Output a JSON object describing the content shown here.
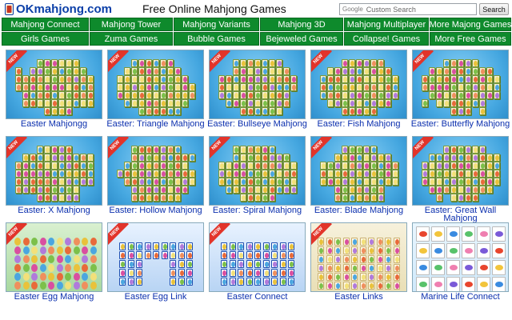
{
  "header": {
    "logo_text": "OKmahjong.com",
    "title": "Free Online Mahjong Games",
    "search_brand": "Google",
    "search_placeholder": "Custom Search",
    "search_button": "Search"
  },
  "nav": {
    "rows": [
      [
        "Mahjong Connect",
        "Mahjong Tower",
        "Mahjong Variants",
        "Mahjong 3D",
        "Mahjong Multiplayer",
        "More Majong Games"
      ],
      [
        "Girls Games",
        "Zuma Games",
        "Bubble Games",
        "Bejeweled Games",
        "Collapse! Games",
        "More Free Games"
      ]
    ]
  },
  "games": [
    {
      "caption": "Easter Mahjongg",
      "new": true,
      "style": "a"
    },
    {
      "caption": "Easter: Triangle Mahjong",
      "new": true,
      "style": "a"
    },
    {
      "caption": "Easter: Bullseye Mahjong",
      "new": true,
      "style": "a"
    },
    {
      "caption": "Easter: Fish Mahjong",
      "new": true,
      "style": "a"
    },
    {
      "caption": "Easter: Butterfly Mahjong",
      "new": true,
      "style": "a"
    },
    {
      "caption": "Easter: X Mahjong",
      "new": true,
      "style": "a"
    },
    {
      "caption": "Easter: Hollow Mahjong",
      "new": true,
      "style": "a"
    },
    {
      "caption": "Easter: Spiral Mahjong",
      "new": true,
      "style": "a"
    },
    {
      "caption": "Easter: Blade Mahjong",
      "new": true,
      "style": "a"
    },
    {
      "caption": "Easter: Great Wall Mahjong",
      "new": true,
      "style": "a"
    },
    {
      "caption": "Easter Egg Mahjong",
      "new": true,
      "style": "b"
    },
    {
      "caption": "Easter Egg Link",
      "new": true,
      "style": "c"
    },
    {
      "caption": "Easter Connect",
      "new": true,
      "style": "c"
    },
    {
      "caption": "Easter Links",
      "new": true,
      "style": "d"
    },
    {
      "caption": "Marine Life Connect",
      "new": false,
      "style": "e"
    }
  ],
  "colors": {
    "nav_green": "#0e8a2c",
    "caption_blue": "#0b2fae",
    "thumb_sky": "#5db8e8",
    "ribbon_red": "#e2342a"
  }
}
